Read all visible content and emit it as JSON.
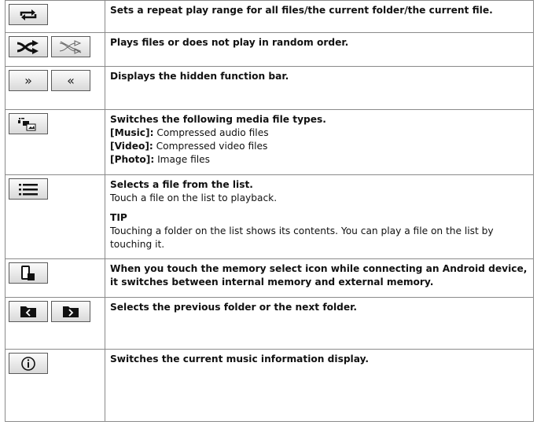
{
  "rows": [
    {
      "icons": [
        "repeat-icon"
      ],
      "heading": "Sets a repeat play range for all files/the current folder/the current file."
    },
    {
      "icons": [
        "shuffle-on-icon",
        "shuffle-off-icon"
      ],
      "heading": "Plays files or does not play in random order."
    },
    {
      "icons": [
        "show-function-bar-icon",
        "hide-function-bar-icon"
      ],
      "icon_glyphs": [
        "»",
        "«"
      ],
      "heading": "Displays the hidden function bar."
    },
    {
      "icons": [
        "media-type-icon"
      ],
      "heading": "Switches the following media file types.",
      "items": [
        {
          "label": "[Music]:",
          "desc": " Compressed audio files"
        },
        {
          "label": "[Video]:",
          "desc": " Compressed video files"
        },
        {
          "label": "[Photo]:",
          "desc": " Image files"
        }
      ]
    },
    {
      "icons": [
        "list-icon"
      ],
      "heading": "Selects a file from the list.",
      "body": "Touch a file on the list to playback.",
      "tip_label": "TIP",
      "tip_text": "Touching a folder on the list shows its contents. You can play a file on the list by touching it."
    },
    {
      "icons": [
        "memory-select-icon"
      ],
      "heading": "When you touch the memory select icon while connecting an Android device, it switches between internal memory and external memory."
    },
    {
      "icons": [
        "previous-folder-icon",
        "next-folder-icon"
      ],
      "heading": "Selects the previous folder or the next folder."
    },
    {
      "icons": [
        "info-icon"
      ],
      "heading": "Switches the current music information display."
    }
  ]
}
